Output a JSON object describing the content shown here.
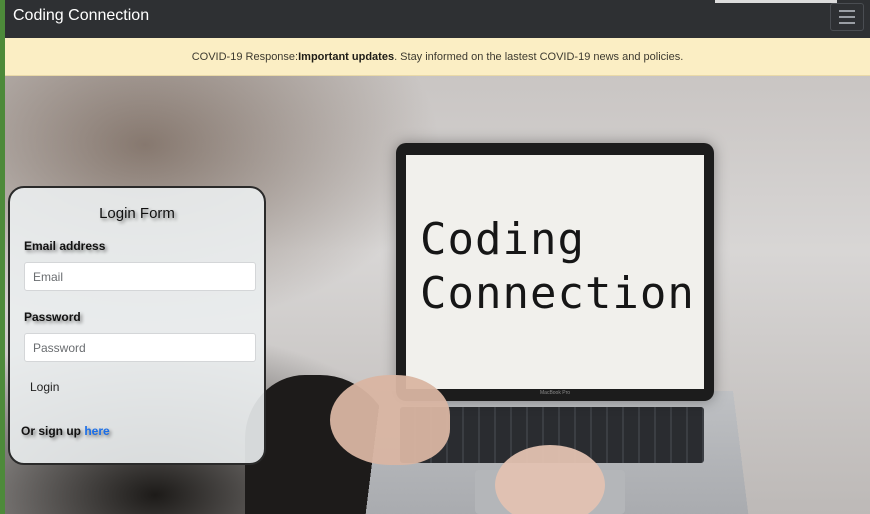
{
  "navbar": {
    "brand": "Coding Connection",
    "toggler_icon": "hamburger-menu-icon"
  },
  "alert": {
    "prefix": "COVID-19 Response:",
    "highlight": "Important updates",
    "suffix": ". Stay informed on the lastest COVID-19 news and policies."
  },
  "hero": {
    "laptop_line1": "Coding",
    "laptop_line2": "Connection",
    "laptop_model": "MacBook Pro"
  },
  "login": {
    "title": "Login Form",
    "email_label": "Email address",
    "email_placeholder": "Email",
    "password_label": "Password",
    "password_placeholder": "Password",
    "submit_label": "Login",
    "signup_prefix": "Or sign up ",
    "signup_link": "here"
  },
  "colors": {
    "navbar_bg": "#2e3033",
    "alert_bg": "#fbeec4",
    "link": "#1a6ee8",
    "accent_bar": "#4d8a3a"
  }
}
